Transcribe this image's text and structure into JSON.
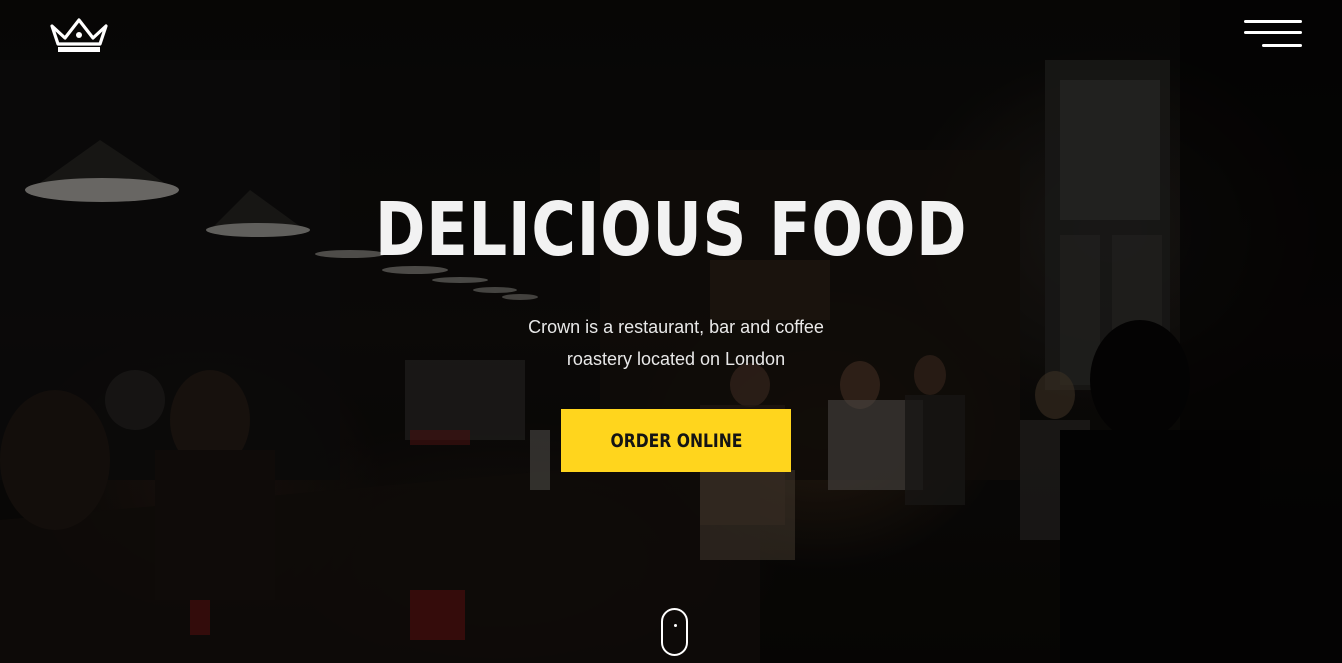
{
  "header": {
    "logo_icon": "crown-icon",
    "menu_icon": "hamburger-menu-icon"
  },
  "hero": {
    "title": "DELICIOUS FOOD",
    "subtitle_line1": "Crown is a restaurant, bar and coffee",
    "subtitle_line2": "roastery located on London",
    "cta_label": "ORDER ONLINE",
    "scroll_icon": "mouse-scroll-icon"
  },
  "colors": {
    "accent": "#ffd51d",
    "text": "#ffffff",
    "background": "#0b0a09"
  }
}
